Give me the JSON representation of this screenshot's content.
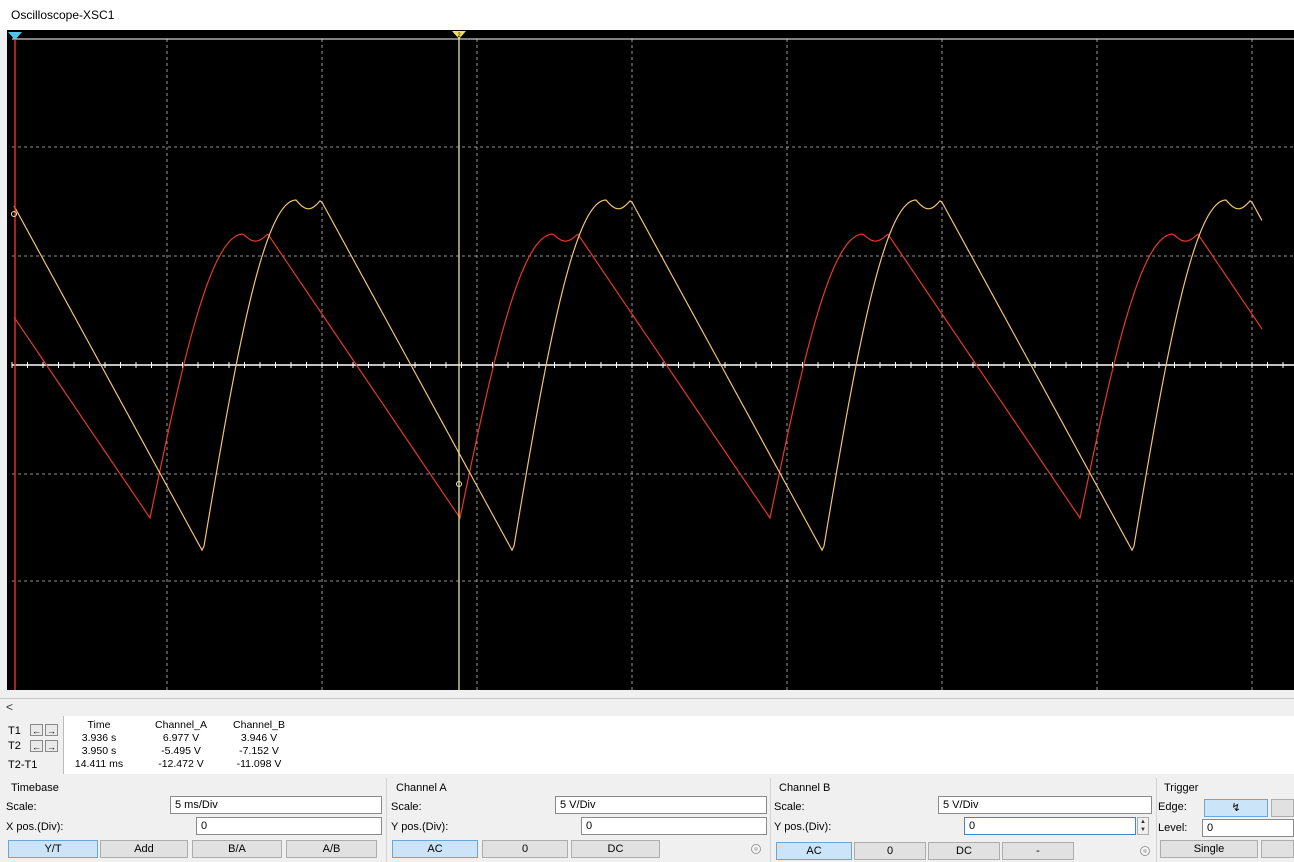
{
  "window": {
    "title": "Oscilloscope-XSC1"
  },
  "colors": {
    "channel_a": "#e33a28",
    "channel_b": "#f1c271",
    "grid": "#ffffff",
    "cursor_t1": "#e8332b",
    "cursor_t2": "#f8f6a0",
    "screen_bg": "#000000"
  },
  "cursors": {
    "t1_label": "1",
    "t2_label": "2"
  },
  "readout": {
    "headers": [
      "Time",
      "Channel_A",
      "Channel_B"
    ],
    "rows": [
      {
        "label": "T1",
        "time": "3.936 s",
        "channel_a": "6.977 V",
        "channel_b": "3.946 V"
      },
      {
        "label": "T2",
        "time": "3.950 s",
        "channel_a": "-5.495 V",
        "channel_b": "-7.152 V"
      },
      {
        "label": "T2-T1",
        "time": "14.411 ms",
        "channel_a": "-12.472 V",
        "channel_b": "-11.098 V"
      }
    ],
    "left_arrow": "←",
    "right_arrow": "→"
  },
  "scroll": {
    "left_arrow": "<"
  },
  "timebase": {
    "title": "Timebase",
    "scale_label": "Scale:",
    "scale_value": "5 ms/Div",
    "xpos_label": "X pos.(Div):",
    "xpos_value": "0",
    "buttons": [
      "Y/T",
      "Add",
      "B/A",
      "A/B"
    ],
    "selected": "Y/T"
  },
  "channel_a": {
    "title": "Channel A",
    "scale_label": "Scale:",
    "scale_value": "5  V/Div",
    "ypos_label": "Y pos.(Div):",
    "ypos_value": "0",
    "buttons": [
      "AC",
      "0",
      "DC"
    ],
    "selected": "AC"
  },
  "channel_b": {
    "title": "Channel B",
    "scale_label": "Scale:",
    "scale_value": "5  V/Div",
    "ypos_label": "Y pos.(Div):",
    "ypos_value": "0",
    "buttons": [
      "AC",
      "0",
      "DC",
      "-"
    ],
    "selected": "AC"
  },
  "trigger": {
    "title": "Trigger",
    "edge_label": "Edge:",
    "edge_symbol": "↯",
    "level_label": "Level:",
    "level_value": "0",
    "single_label": "Single"
  }
}
